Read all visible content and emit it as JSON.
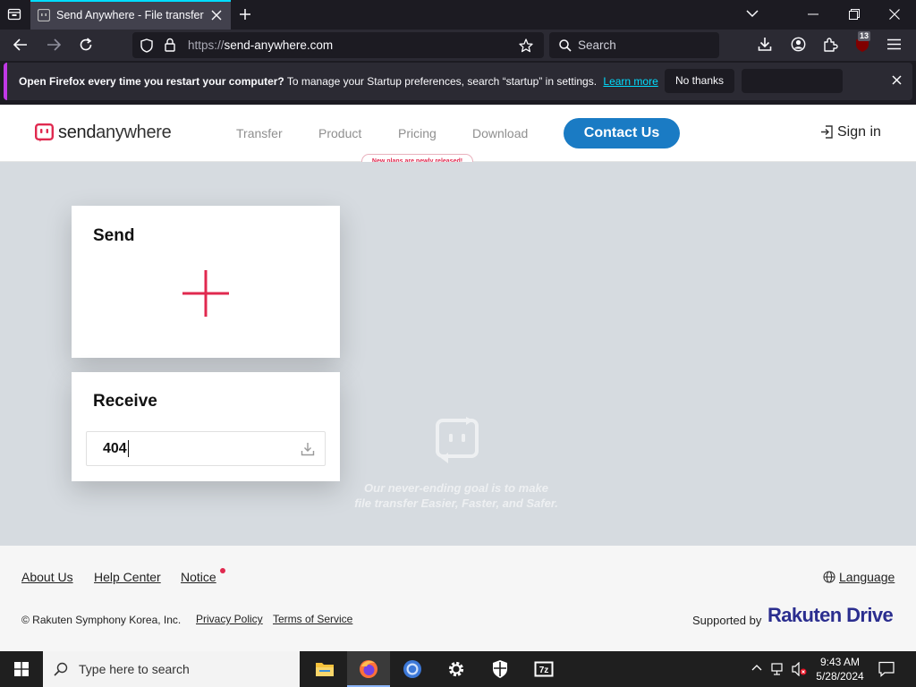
{
  "browser": {
    "tab_title": "Send Anywhere - File transfer",
    "url_prefix": "https://",
    "url_domain": "send-anywhere.com",
    "search_placeholder": "Search",
    "extension_badge": "13"
  },
  "notification": {
    "bold_text": "Open Firefox every time you restart your computer?",
    "text": "To manage your Startup preferences, search “startup” in settings.",
    "link": "Learn more",
    "no_thanks": "No thanks"
  },
  "site": {
    "logo_send": "send",
    "logo_anywhere": "anywhere",
    "nav": [
      "Transfer",
      "Product",
      "Pricing",
      "Download"
    ],
    "contact_button": "Contact Us",
    "new_plans_badge": "New plans are newly released!",
    "sign_in": "Sign in",
    "send_title": "Send",
    "receive_title": "Receive",
    "receive_code": "404",
    "tagline_line1": "Our never-ending goal is to make",
    "tagline_line2": "file transfer Easier, Faster, and Safer.",
    "brand_color": "#e0294f",
    "accent_color": "#1a7bc4"
  },
  "footer": {
    "links": [
      "About Us",
      "Help Center",
      "Notice"
    ],
    "language": "Language",
    "copyright": "© Rakuten Symphony Korea, Inc.",
    "privacy": "Privacy Policy",
    "terms": "Terms of Service",
    "supported_by": "Supported by",
    "rakuten_logo": "Rakuten Drive"
  },
  "taskbar": {
    "search_placeholder": "Type here to search",
    "time": "9:43 AM",
    "date": "5/28/2024",
    "apps": [
      "file-explorer-icon",
      "firefox-icon",
      "chrome-icon",
      "settings-icon",
      "defender-icon",
      "7zip-icon"
    ]
  }
}
